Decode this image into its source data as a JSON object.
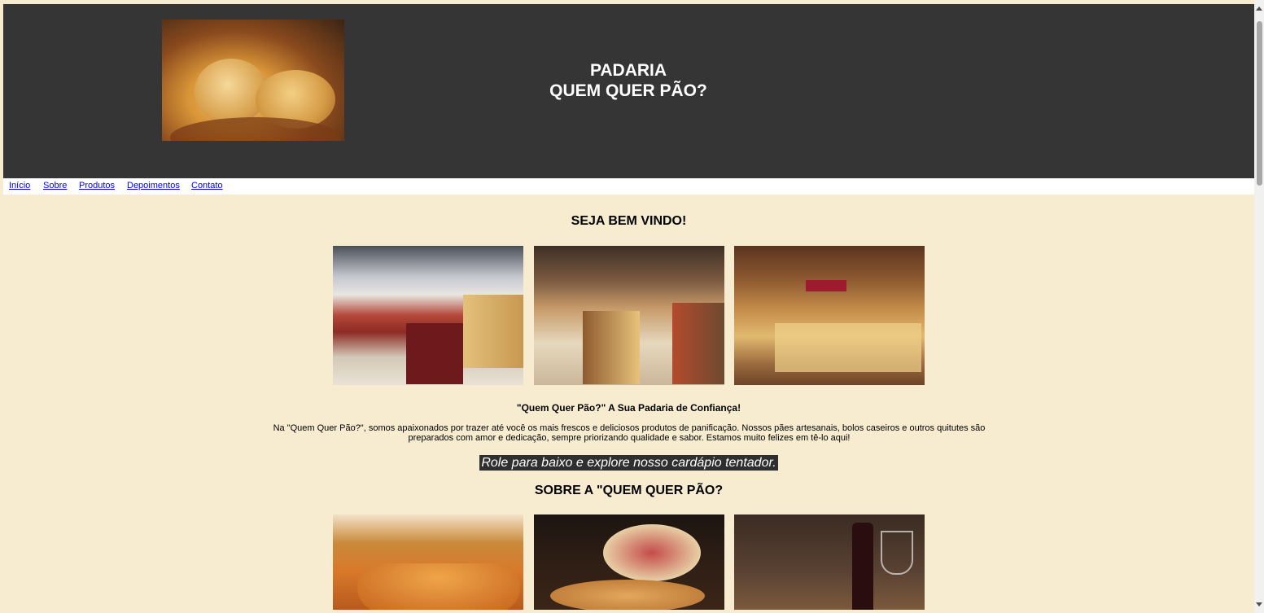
{
  "header": {
    "title_line1": "PADARIA",
    "title_line2": "QUEM QUER PÃO?"
  },
  "nav": {
    "items": [
      "Início",
      "Sobre",
      "Produtos",
      "Depoimentos",
      "Contato"
    ]
  },
  "welcome": {
    "heading": "SEJA BEM VINDO!",
    "subheading": "\"Quem Quer Pão?\" A Sua Padaria de Confiança!",
    "paragraph": "Na \"Quem Quer Pão?\", somos apaixonados por trazer até você os mais frescos e deliciosos produtos de panificação. Nossos pães artesanais, bolos caseiros e outros quitutes são preparados com amor e dedicação, sempre priorizando qualidade e sabor. Estamos muito felizes em tê-lo aqui!",
    "cta": "Role para baixo e explore nosso cardápio tentador."
  },
  "about": {
    "heading": "SOBRE A \"QUEM QUER PÃO?"
  },
  "colors": {
    "header_bg": "#353535",
    "page_bg": "#f7ecd0",
    "link": "#0000ee"
  }
}
